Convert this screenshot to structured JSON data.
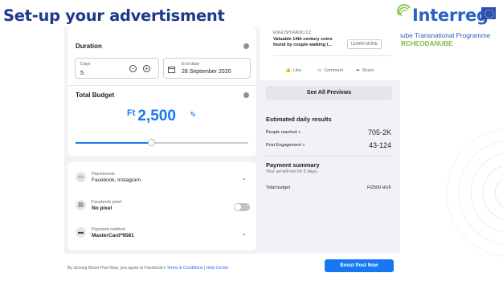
{
  "slide": {
    "title": "Set-up your advertisment"
  },
  "logo": {
    "wordmark": "Interreg",
    "subtitle_line1": "anube Transnational Programme",
    "subtitle_line2": "RCHEODANUBE"
  },
  "duration": {
    "title": "Duration",
    "days_label": "Days",
    "days_value": "5",
    "end_date_label": "End date",
    "end_date_value": "28 September 2020"
  },
  "budget": {
    "title": "Total Budget",
    "currency": "Ft",
    "amount": "2,500",
    "slider_fraction": 0.44
  },
  "settings": {
    "placements_label": "Placements",
    "placements_value": "Facebook, Instagram",
    "pixel_label": "Facebook pixel",
    "pixel_value": "No pixel",
    "payment_label": "Payment method",
    "payment_value": "MasterCard*9581"
  },
  "preview": {
    "source": "ENGLISH.RADIO.CZ",
    "headline_line1": "Valuable 14th century coins",
    "headline_line2": "found by couple walking i...",
    "learn_more": "LEARN MORE",
    "like": "Like",
    "comment": "Comment",
    "share": "Share",
    "see_all": "See All Previews"
  },
  "results": {
    "title": "Estimated daily results",
    "reached_label": "People reached",
    "reached_value": "705-2K",
    "engagement_label": "Post Engagement",
    "engagement_value": "43-124"
  },
  "payment": {
    "title": "Payment summary",
    "subtitle": "Your ad will run for 5 days.",
    "total_label": "Total budget",
    "total_value": "Ft2500 HUF"
  },
  "footer": {
    "prefix": "By clicking Boost Post Now, you agree to Facebook's",
    "terms": "Terms & Conditions",
    "separator": "|",
    "help": "Help Centre",
    "boost_button": "Boost Post Now"
  },
  "colors": {
    "accent": "#1877f2",
    "title": "#1f3a8a",
    "interreg_blue": "#2b63c2",
    "interreg_green": "#7cbf3b"
  }
}
